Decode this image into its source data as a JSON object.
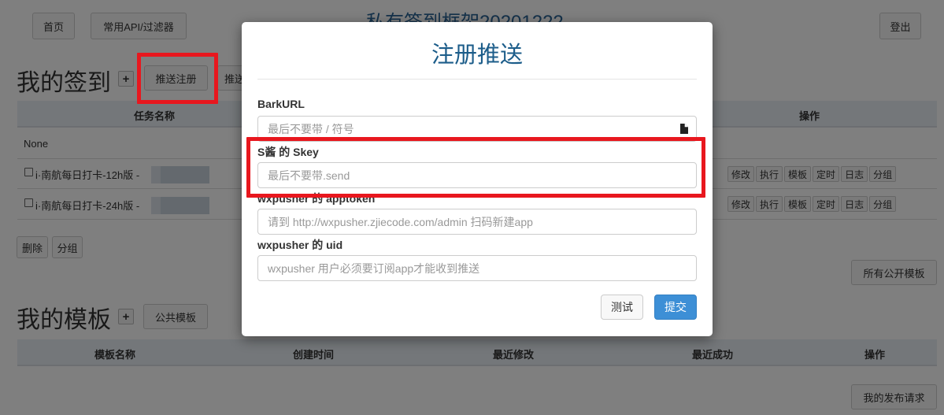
{
  "header": {
    "home_label": "首页",
    "api_label": "常用API/过滤器",
    "site_title": "私有签到框架20201222",
    "logout_label": "登出"
  },
  "my_tasks": {
    "title": "我的签到",
    "push_register_label": "推送注册",
    "push_settings_label": "推送设置",
    "columns": {
      "name": "任务名称",
      "actions": "操作"
    },
    "rows": [
      {
        "name": "None"
      },
      {
        "name": "i·南航每日打卡-12h版 -"
      },
      {
        "name": "i·南航每日打卡-24h版 -"
      }
    ],
    "row_actions": [
      "修改",
      "执行",
      "模板",
      "定时",
      "日志",
      "分组"
    ],
    "delete_label": "删除",
    "group_label": "分组",
    "public_templates_label": "所有公开模板"
  },
  "my_templates": {
    "title": "我的模板",
    "public_label": "公共模板",
    "columns": [
      "模板名称",
      "创建时间",
      "最近修改",
      "最近成功",
      "操作"
    ],
    "my_requests_label": "我的发布请求"
  },
  "modal": {
    "title": "注册推送",
    "fields": [
      {
        "label": "BarkURL",
        "placeholder": "最后不要带 / 符号"
      },
      {
        "label": "S酱 的 Skey",
        "placeholder": "最后不要带.send"
      },
      {
        "label": "wxpusher 的 apptoken",
        "placeholder": "请到 http://wxpusher.zjiecode.com/admin 扫码新建app"
      },
      {
        "label": "wxpusher 的 uid",
        "placeholder": "wxpusher 用户必须要订阅app才能收到推送"
      }
    ],
    "test_label": "测试",
    "submit_label": "提交"
  },
  "colors": {
    "highlight": "#e8171e",
    "primary": "#3d8fd6",
    "title_blue": "#1c5d8a"
  }
}
